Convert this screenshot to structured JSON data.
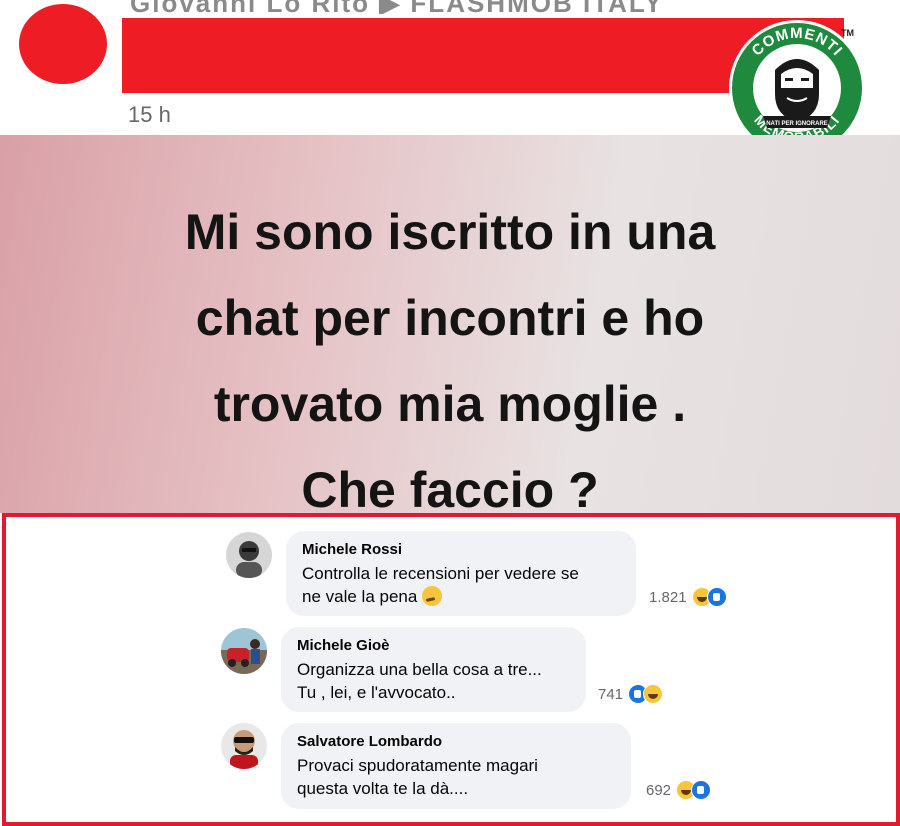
{
  "post": {
    "author_ghost": "Giovanni Lo Rito ▶ FLASHMOB ITALY",
    "timestamp": "15 h"
  },
  "logo": {
    "text_top": "COMMENTI",
    "text_bottom": "MEMORABILI",
    "tagline": "NATI PER IGNORARE",
    "tm": "TM",
    "colors": {
      "ring": "#1f8a3e",
      "face": "#ffffff"
    }
  },
  "meme": {
    "lines": [
      "Mi sono iscritto in una",
      "chat per incontri e ho",
      "trovato mia moglie .",
      "Che faccio ?"
    ]
  },
  "comments": [
    {
      "name": "Michele Rossi",
      "text": "Controlla le recensioni per vedere se\nne vale la pena",
      "emoji": "thinking-face",
      "reactions": "1.821",
      "reaction_icons": [
        "haha",
        "like"
      ]
    },
    {
      "name": "Michele Gioè",
      "text": "Organizza una bella cosa a tre...\nTu , lei, e l'avvocato..",
      "reactions": "741",
      "reaction_icons": [
        "like",
        "haha"
      ]
    },
    {
      "name": "Salvatore Lombardo",
      "text": "Provaci spudoratamente magari\nquesta volta te la dà....",
      "reactions": "692",
      "reaction_icons": [
        "haha",
        "like"
      ]
    }
  ],
  "colors": {
    "redact": "#ee1c24",
    "frame": "#e3192f",
    "bubble": "#f0f2f5"
  }
}
